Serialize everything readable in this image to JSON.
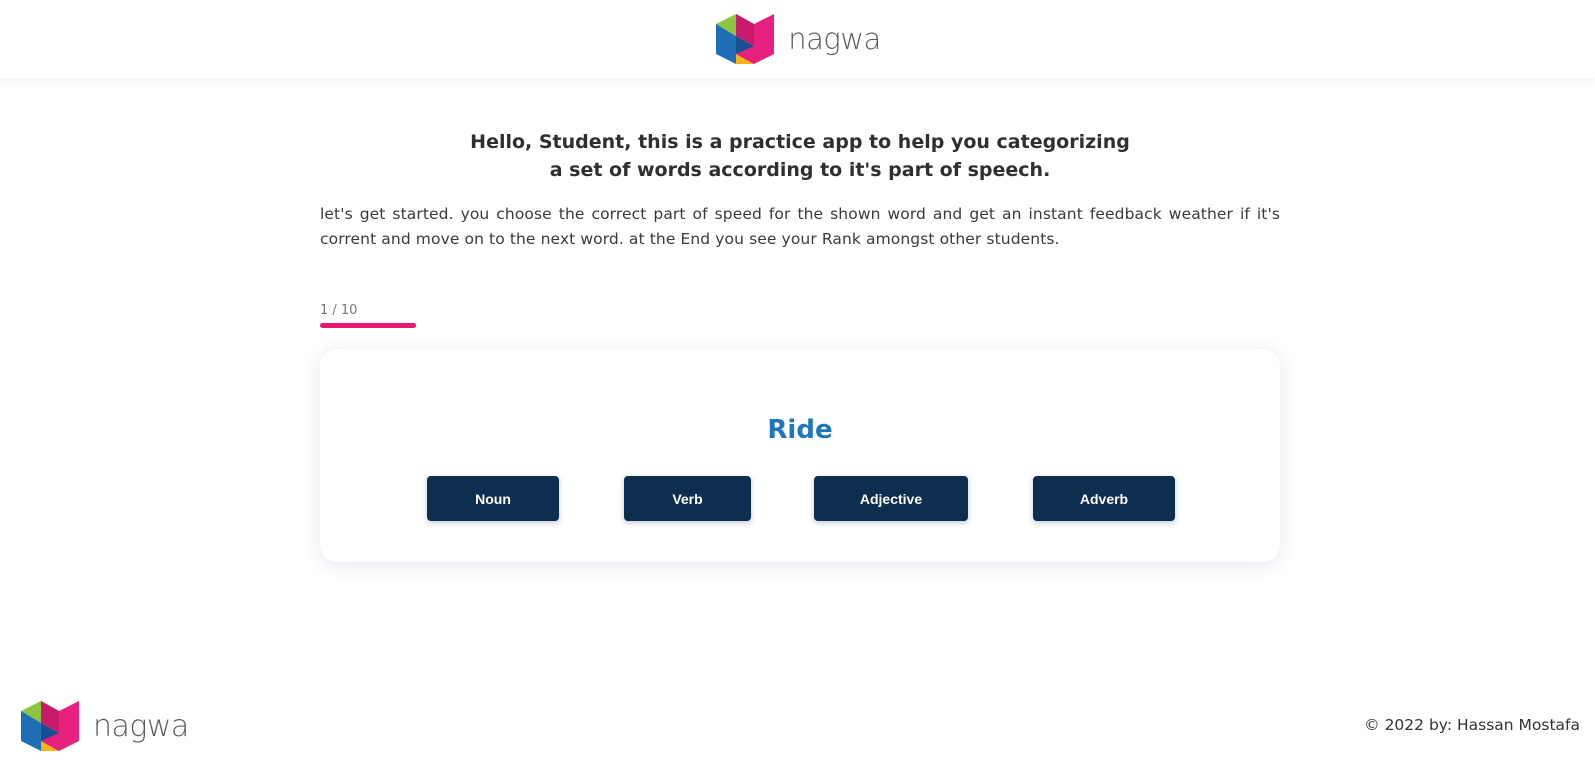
{
  "header": {
    "logo_icon": "nagwa-logo-icon",
    "brand_name": "nagwa"
  },
  "intro": {
    "title_line1": "Hello, Student, this is a practice app to help you categorizing",
    "title_line2": "a set of words according to it's part of speech.",
    "description": "let's get started. you choose the correct part of speed for the shown word and get an instant feedback weather if it's corrent and move on to the next word. at the End you see your Rank amongst other students."
  },
  "progress": {
    "label": "1 / 10",
    "current": 1,
    "total": 10,
    "color": "#e6186f"
  },
  "question": {
    "word": "Ride",
    "word_color": "#1f76b8",
    "options": [
      "Noun",
      "Verb",
      "Adjective",
      "Adverb"
    ],
    "button_color": "#0d2e4e"
  },
  "footer": {
    "logo_icon": "nagwa-logo-icon",
    "brand_name": "nagwa",
    "copyright": "© 2022 by: Hassan Mostafa"
  },
  "logo_colors": {
    "green": "#8cc63f",
    "magenta": "#e6217f",
    "blue": "#1f6fb6",
    "yellow": "#f5b316"
  }
}
